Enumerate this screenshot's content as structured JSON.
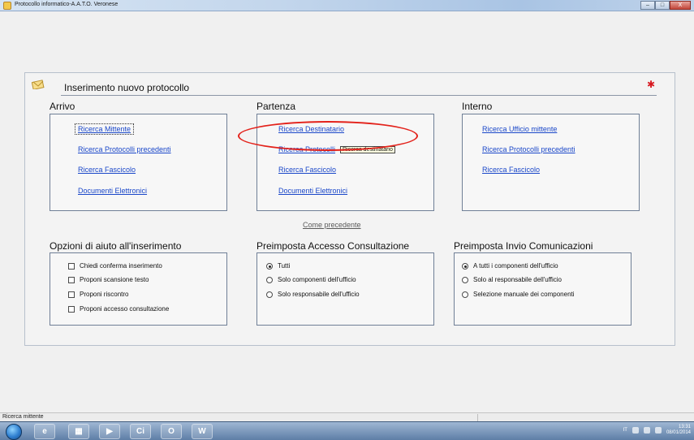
{
  "window": {
    "title": "Protocollo informatico-A.A.T.O. Veronese",
    "buttons": [
      "–",
      "□",
      "X"
    ]
  },
  "panel": {
    "title": "Inserimento nuovo protocollo"
  },
  "arrivo": {
    "title": "Arrivo",
    "links": [
      "Ricerca Mittente",
      "Ricerca Protocolli precedenti",
      "Ricerca Fascicolo",
      "Documenti Elettronici"
    ]
  },
  "partenza": {
    "title": "Partenza",
    "links": [
      "Ricerca Destinatario",
      "Ricerca Protocolli",
      "Ricerca Fascicolo",
      "Documenti Elettronici"
    ],
    "tooltip": "Ricerca destinatario"
  },
  "interno": {
    "title": "Interno",
    "links": [
      "Ricerca Ufficio mittente",
      "Ricerca Protocolli precedenti",
      "Ricerca Fascicolo"
    ]
  },
  "come_precedente": "Come precedente",
  "opzioni": {
    "title": "Opzioni di aiuto all'inserimento",
    "items": [
      "Chiedi conferma inserimento",
      "Proponi scansione testo",
      "Proponi riscontro",
      "Proponi accesso consultazione"
    ]
  },
  "accesso": {
    "title": "Preimposta Accesso Consultazione",
    "items": [
      "Tutti",
      "Solo componenti dell'ufficio",
      "Solo responsabile dell'ufficio"
    ],
    "selected": "Tutti"
  },
  "invio": {
    "title": "Preimposta Invio Comunicazioni",
    "items": [
      "A tutti i componenti dell'ufficio",
      "Solo al responsabile dell'ufficio",
      "Selezione manuale dei componenti"
    ],
    "selected": "A tutti i componenti dell'ufficio"
  },
  "statusbar": {
    "text": "Ricerca mittente"
  },
  "taskbar": {
    "lang": "IT",
    "time": "13:31",
    "date": "08/01/2014",
    "apps": [
      "e",
      "▦",
      "▶",
      "Ci",
      "O",
      "W"
    ]
  },
  "colors": {
    "link": "#1a47c9",
    "highlight_oval": "#e3221b"
  }
}
